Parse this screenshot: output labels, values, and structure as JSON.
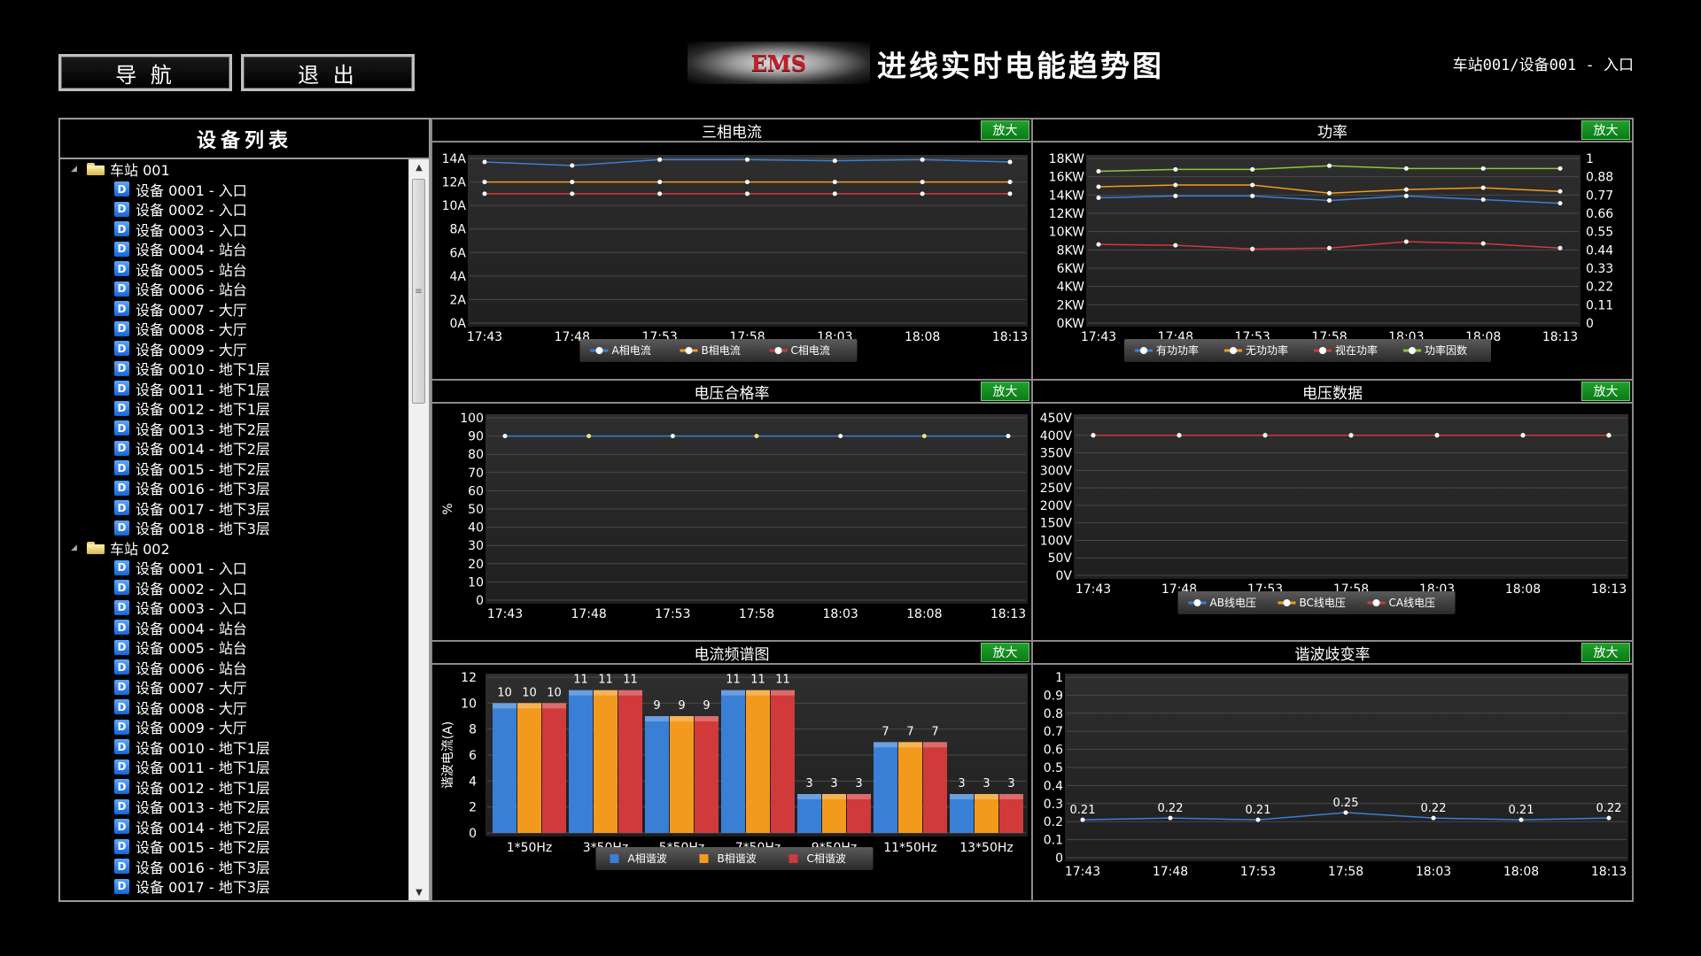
{
  "header": {
    "nav_label": "导 航",
    "exit_label": "退 出",
    "logo": "EMS",
    "title": "进线实时电能趋势图",
    "device_info": "车站001/设备001 - 入口"
  },
  "device_panel": {
    "title": "设备列表",
    "stations": [
      {
        "name": "车站 001",
        "devices": [
          "设备 0001 - 入口",
          "设备 0002 - 入口",
          "设备 0003 - 入口",
          "设备 0004 - 站台",
          "设备 0005 - 站台",
          "设备 0006 - 站台",
          "设备 0007 - 大厅",
          "设备 0008 - 大厅",
          "设备 0009 - 大厅",
          "设备 0010 - 地下1层",
          "设备 0011 - 地下1层",
          "设备 0012 - 地下1层",
          "设备 0013 - 地下2层",
          "设备 0014 - 地下2层",
          "设备 0015 - 地下2层",
          "设备 0016 - 地下3层",
          "设备 0017 - 地下3层",
          "设备 0018 - 地下3层"
        ]
      },
      {
        "name": "车站 002",
        "devices": [
          "设备 0001 - 入口",
          "设备 0002 - 入口",
          "设备 0003 - 入口",
          "设备 0004 - 站台",
          "设备 0005 - 站台",
          "设备 0006 - 站台",
          "设备 0007 - 大厅",
          "设备 0008 - 大厅",
          "设备 0009 - 大厅",
          "设备 0010 - 地下1层",
          "设备 0011 - 地下1层",
          "设备 0012 - 地下1层",
          "设备 0013 - 地下2层",
          "设备 0014 - 地下2层",
          "设备 0015 - 地下2层",
          "设备 0016 - 地下3层",
          "设备 0017 - 地下3层"
        ]
      }
    ]
  },
  "zoom_label": "放大",
  "colors": {
    "blue": "#3a7fd6",
    "orange": "#f39a1e",
    "red": "#d03a3a",
    "green": "#8cc63f"
  },
  "chart_data": [
    {
      "id": "current",
      "title": "三相电流",
      "type": "line",
      "x": [
        "17:43",
        "17:48",
        "17:53",
        "17:58",
        "18:03",
        "18:08",
        "18:13"
      ],
      "yticks": [
        "0A",
        "2A",
        "4A",
        "6A",
        "8A",
        "10A",
        "12A",
        "14A"
      ],
      "ylim": [
        0,
        14
      ],
      "series": [
        {
          "name": "A相电流",
          "color": "#3a7fd6",
          "values": [
            13.7,
            13.4,
            13.9,
            13.9,
            13.8,
            13.9,
            13.7
          ]
        },
        {
          "name": "B相电流",
          "color": "#f39a1e",
          "values": [
            12,
            12,
            12,
            12,
            12,
            12,
            12
          ]
        },
        {
          "name": "C相电流",
          "color": "#d03a3a",
          "values": [
            11,
            11,
            11,
            11,
            11,
            11,
            11
          ]
        }
      ],
      "legend": [
        "A相电流",
        "B相电流",
        "C相电流"
      ]
    },
    {
      "id": "power",
      "title": "功率",
      "type": "line",
      "x": [
        "17:43",
        "17:48",
        "17:53",
        "17:58",
        "18:03",
        "18:08",
        "18:13"
      ],
      "yticks": [
        "0KW",
        "2KW",
        "4KW",
        "6KW",
        "8KW",
        "10KW",
        "12KW",
        "14KW",
        "16KW",
        "18KW"
      ],
      "ylim": [
        0,
        18
      ],
      "y2ticks": [
        "0",
        "0.11",
        "0.22",
        "0.33",
        "0.44",
        "0.55",
        "0.66",
        "0.77",
        "0.88",
        "1"
      ],
      "y2lim": [
        0,
        1
      ],
      "series": [
        {
          "name": "有功功率",
          "color": "#3a7fd6",
          "values": [
            13.7,
            13.9,
            13.9,
            13.4,
            13.9,
            13.5,
            13.1
          ]
        },
        {
          "name": "无功功率",
          "color": "#f39a1e",
          "values": [
            14.9,
            15.1,
            15.1,
            14.2,
            14.6,
            14.8,
            14.4
          ]
        },
        {
          "name": "视在功率",
          "color": "#d03a3a",
          "values": [
            8.6,
            8.5,
            8.1,
            8.2,
            8.9,
            8.7,
            8.2
          ]
        },
        {
          "name": "功率因数",
          "color": "#8cc63f",
          "values": [
            16.6,
            16.8,
            16.8,
            17.2,
            16.9,
            16.9,
            16.9
          ]
        }
      ],
      "legend": [
        "有功功率",
        "无功功率",
        "视在功率",
        "功率因数"
      ]
    },
    {
      "id": "voltage_rate",
      "title": "电压合格率",
      "type": "line",
      "x": [
        "17:43",
        "17:48",
        "17:53",
        "17:58",
        "18:03",
        "18:08",
        "18:13"
      ],
      "yticks": [
        "0",
        "10",
        "20",
        "30",
        "40",
        "50",
        "60",
        "70",
        "80",
        "90",
        "100"
      ],
      "ylim": [
        0,
        100
      ],
      "ylabel": "%",
      "series": [
        {
          "name": "",
          "color": "#3a7fd6",
          "values": [
            90,
            90,
            90,
            90,
            90,
            90,
            90
          ]
        }
      ],
      "legend": []
    },
    {
      "id": "voltage",
      "title": "电压数据",
      "type": "line",
      "x": [
        "17:43",
        "17:48",
        "17:53",
        "17:58",
        "18:03",
        "18:08",
        "18:13"
      ],
      "yticks": [
        "0V",
        "50V",
        "100V",
        "150V",
        "200V",
        "250V",
        "300V",
        "350V",
        "400V",
        "450V"
      ],
      "ylim": [
        0,
        450
      ],
      "series": [
        {
          "name": "AB线电压",
          "color": "#3a7fd6",
          "values": [
            400,
            400,
            400,
            400,
            400,
            400,
            400
          ]
        },
        {
          "name": "BC线电压",
          "color": "#f39a1e",
          "values": [
            400,
            400,
            400,
            400,
            400,
            400,
            400
          ]
        },
        {
          "name": "CA线电压",
          "color": "#d03a3a",
          "values": [
            400,
            400,
            400,
            400,
            400,
            400,
            400
          ]
        }
      ],
      "legend": [
        "AB线电压",
        "BC线电压",
        "CA线电压"
      ]
    },
    {
      "id": "spectrum",
      "title": "电流频谱图",
      "type": "bar",
      "categories": [
        "1*50Hz",
        "3*50Hz",
        "5*50Hz",
        "7*50Hz",
        "9*50Hz",
        "11*50Hz",
        "13*50Hz"
      ],
      "yticks": [
        "0",
        "2",
        "4",
        "6",
        "8",
        "10",
        "12"
      ],
      "ylim": [
        0,
        12
      ],
      "ylabel": "谐波电流(A)",
      "series": [
        {
          "name": "A相谐波",
          "color": "#3a7fd6",
          "values": [
            10,
            11,
            9,
            11,
            3,
            7,
            3
          ]
        },
        {
          "name": "B相谐波",
          "color": "#f39a1e",
          "values": [
            10,
            11,
            9,
            11,
            3,
            7,
            3
          ]
        },
        {
          "name": "C相谐波",
          "color": "#d03a3a",
          "values": [
            10,
            11,
            9,
            11,
            3,
            7,
            3
          ]
        }
      ],
      "legend": [
        "A相谐波",
        "B相谐波",
        "C相谐波"
      ]
    },
    {
      "id": "thd",
      "title": "谐波歧变率",
      "type": "line",
      "x": [
        "17:43",
        "17:48",
        "17:53",
        "17:58",
        "18:03",
        "18:08",
        "18:13"
      ],
      "yticks": [
        "0",
        "0.1",
        "0.2",
        "0.3",
        "0.4",
        "0.5",
        "0.6",
        "0.7",
        "0.8",
        "0.9",
        "1"
      ],
      "ylim": [
        0,
        1
      ],
      "series": [
        {
          "name": "",
          "color": "#3a7fd6",
          "values": [
            0.21,
            0.22,
            0.21,
            0.25,
            0.22,
            0.21,
            0.22
          ],
          "labels": [
            "0.21",
            "0.22",
            "0.21",
            "0.25",
            "0.22",
            "0.21",
            "0.22"
          ]
        }
      ],
      "legend": []
    }
  ]
}
